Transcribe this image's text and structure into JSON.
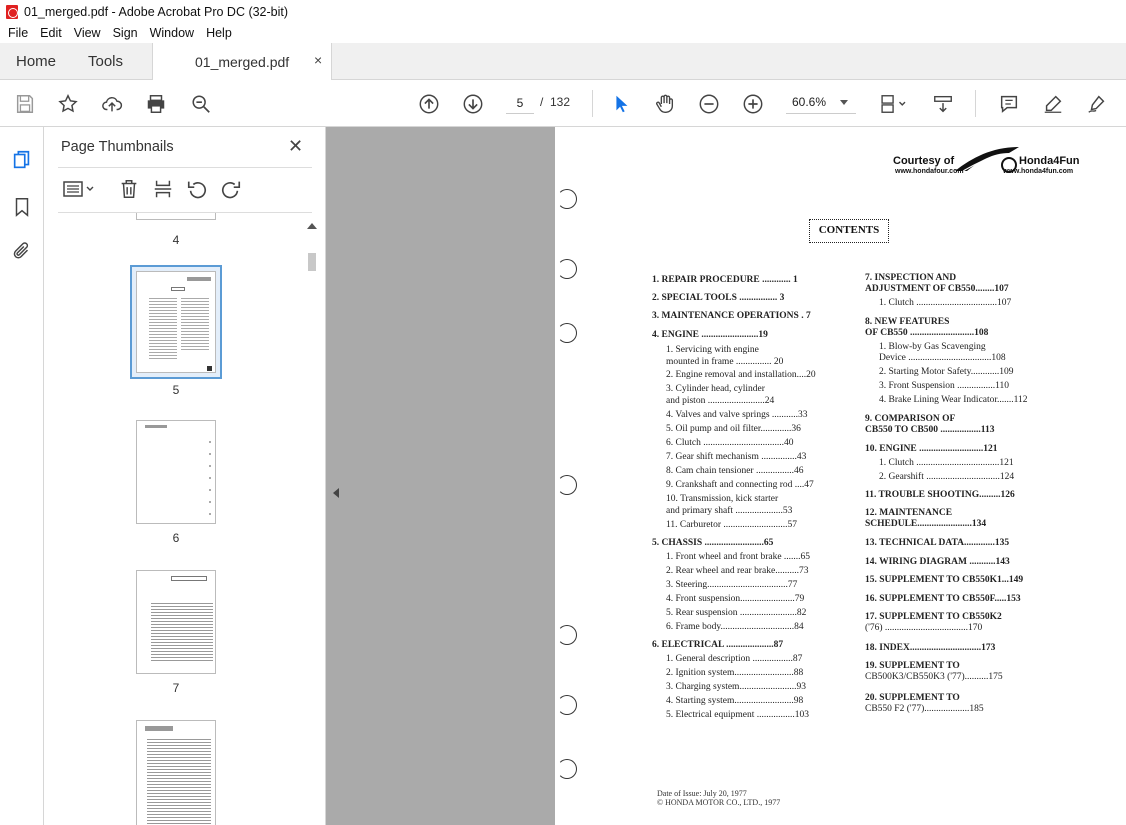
{
  "window": {
    "title": "01_merged.pdf - Adobe Acrobat Pro DC (32-bit)"
  },
  "menu": [
    "File",
    "Edit",
    "View",
    "Sign",
    "Window",
    "Help"
  ],
  "tabs": {
    "home": "Home",
    "tools": "Tools",
    "document": "01_merged.pdf",
    "close": "×"
  },
  "toolbar": {
    "page_current": "5",
    "page_sep": "/",
    "page_total": "132",
    "zoom": "60.6%"
  },
  "panel": {
    "title": "Page Thumbnails",
    "close": "✕",
    "thumb_labels": [
      "4",
      "5",
      "6",
      "7"
    ]
  },
  "pdf": {
    "courtesy": "Courtesy of",
    "brand": "Honda4Fun",
    "url1": "www.hondafour.com",
    "url2": "www.honda4fun.com",
    "contents": "CONTENTS",
    "left_col": [
      "1. REPAIR PROCEDURE ............ 1",
      "2. SPECIAL TOOLS ................ 3",
      "3. MAINTENANCE OPERATIONS . 7",
      "4. ENGINE ........................19",
      "1. Servicing with engine",
      "mounted in frame ............... 20",
      "2. Engine removal and installation....20",
      "3. Cylinder head, cylinder",
      "and piston ........................24",
      "4. Valves and valve springs ...........33",
      "5. Oil pump and oil filter.............36",
      "6. Clutch ..................................40",
      "7. Gear shift mechanism ...............43",
      "8. Cam chain tensioner ................46",
      "9. Crankshaft and connecting rod ....47",
      "10. Transmission, kick starter",
      "and primary shaft ....................53",
      "11. Carburetor ...........................57",
      "5. CHASSIS .........................65",
      "1. Front wheel and front brake .......65",
      "2. Rear wheel and rear brake..........73",
      "3. Steering..................................77",
      "4. Front suspension.......................79",
      "5. Rear suspension ........................82",
      "6. Frame body...............................84",
      "6. ELECTRICAL ....................87",
      "1. General description .................87",
      "2. Ignition system.........................88",
      "3. Charging system........................93",
      "4. Starting system.........................98",
      "5. Electrical equipment ................103"
    ],
    "right_col": [
      "7. INSPECTION AND",
      "ADJUSTMENT OF CB550........107",
      "1. Clutch ..................................107",
      "8. NEW FEATURES",
      "OF CB550 ...........................108",
      "1. Blow-by Gas Scavenging",
      "Device ...................................108",
      "2. Starting Motor Safety............109",
      "3. Front Suspension ................110",
      "4. Brake Lining Wear Indicator.......112",
      "9. COMPARISON OF",
      "CB550 TO CB500 .................113",
      "10. ENGINE ...........................121",
      "1. Clutch ...................................121",
      "2. Gearshift ...............................124",
      "11. TROUBLE SHOOTING.........126",
      "12. MAINTENANCE",
      "SCHEDULE.......................134",
      "13. TECHNICAL DATA.............135",
      "14. WIRING DIAGRAM ...........143",
      "15. SUPPLEMENT TO CB550K1...149",
      "16. SUPPLEMENT TO CB550F.....153",
      "17. SUPPLEMENT TO CB550K2",
      "('76) ...................................170",
      "18. INDEX..............................173",
      "19. SUPPLEMENT TO",
      "CB500K3/CB550K3 ('77)..........175",
      "20. SUPPLEMENT TO",
      "CB550 F2 ('77)...................185"
    ],
    "footer1": "Date of Issue: July 20, 1977",
    "footer2": "© HONDA MOTOR CO., LTD., 1977"
  }
}
